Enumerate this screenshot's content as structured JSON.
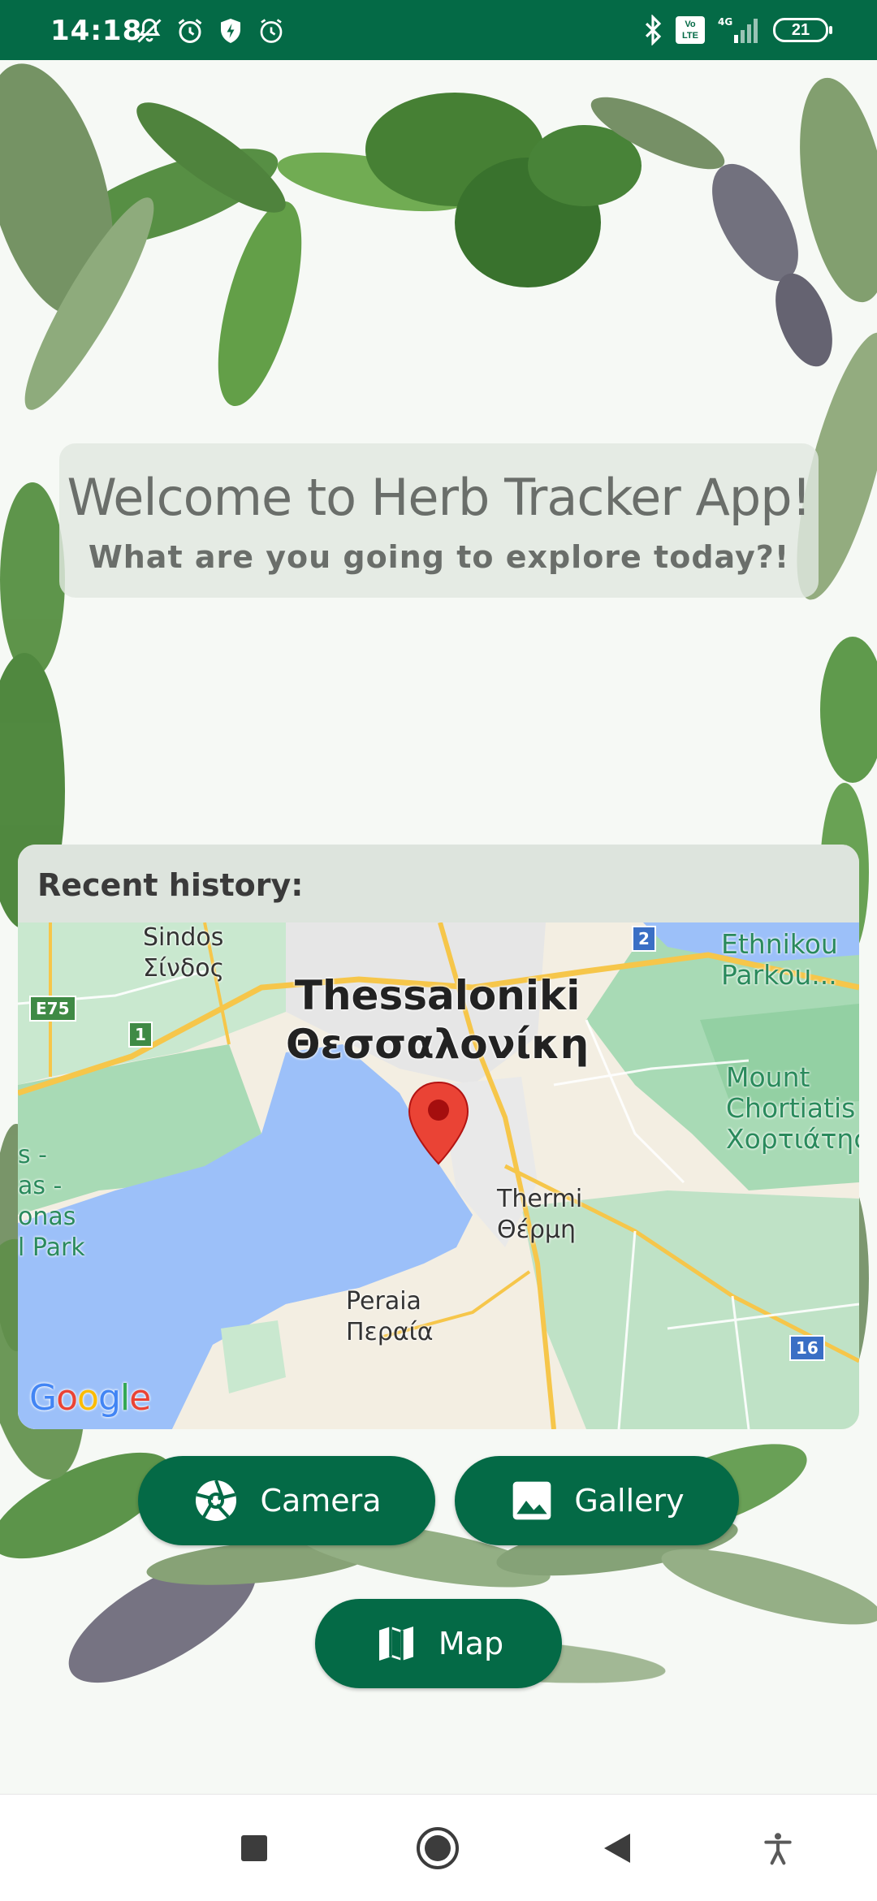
{
  "status_bar": {
    "time": "14:18",
    "left_icons": [
      "bell-off-icon",
      "alarm-icon",
      "shield-bolt-icon",
      "alarm-outline-icon"
    ],
    "right_icons": [
      "bluetooth-icon",
      "volte-icon",
      "signal-4g-icon",
      "battery-icon"
    ],
    "volte_label": "Vo LTE",
    "network_label": "4G",
    "battery_level": "21"
  },
  "welcome": {
    "title": "Welcome to Herb Tracker App!",
    "subtitle": "What are you going to explore today?!"
  },
  "history": {
    "title": "Recent history:"
  },
  "map": {
    "city_name": "Thessaloniki",
    "city_name_local": "Θεσσαλονίκη",
    "sindos": "Sindos",
    "sindos_local": "Σίνδος",
    "thermi": "Thermi",
    "thermi_local": "Θέρμη",
    "peraia": "Peraia",
    "peraia_local": "Περαία",
    "mount_line1": "Mount",
    "mount_line2": "Chortiatis",
    "mount_local": "Χορτιάτης",
    "park_line1": "Ethnikou",
    "park_line2": "Parkou...",
    "left_line1": "s -",
    "left_line2": "as -",
    "left_line3": "onas",
    "left_line4": "l Park",
    "road_e75": "E75",
    "road_1": "1",
    "road_2": "2",
    "road_16": "16",
    "attribution": "Google",
    "colors": {
      "water": "#9cc0f9",
      "land": "#f3eee2",
      "park": "#a8dab5",
      "urban": "#e8e8e8",
      "highway": "#f6c64a",
      "pin": "#ea4335"
    }
  },
  "buttons": {
    "camera": "Camera",
    "gallery": "Gallery",
    "map": "Map"
  },
  "nav": {
    "icons": [
      "recents-square-icon",
      "home-circle-icon",
      "back-triangle-icon",
      "accessibility-icon"
    ]
  },
  "colors": {
    "primary": "#046a46",
    "card_bg": "#e0e8e0",
    "text_muted": "#6a6e6a"
  }
}
